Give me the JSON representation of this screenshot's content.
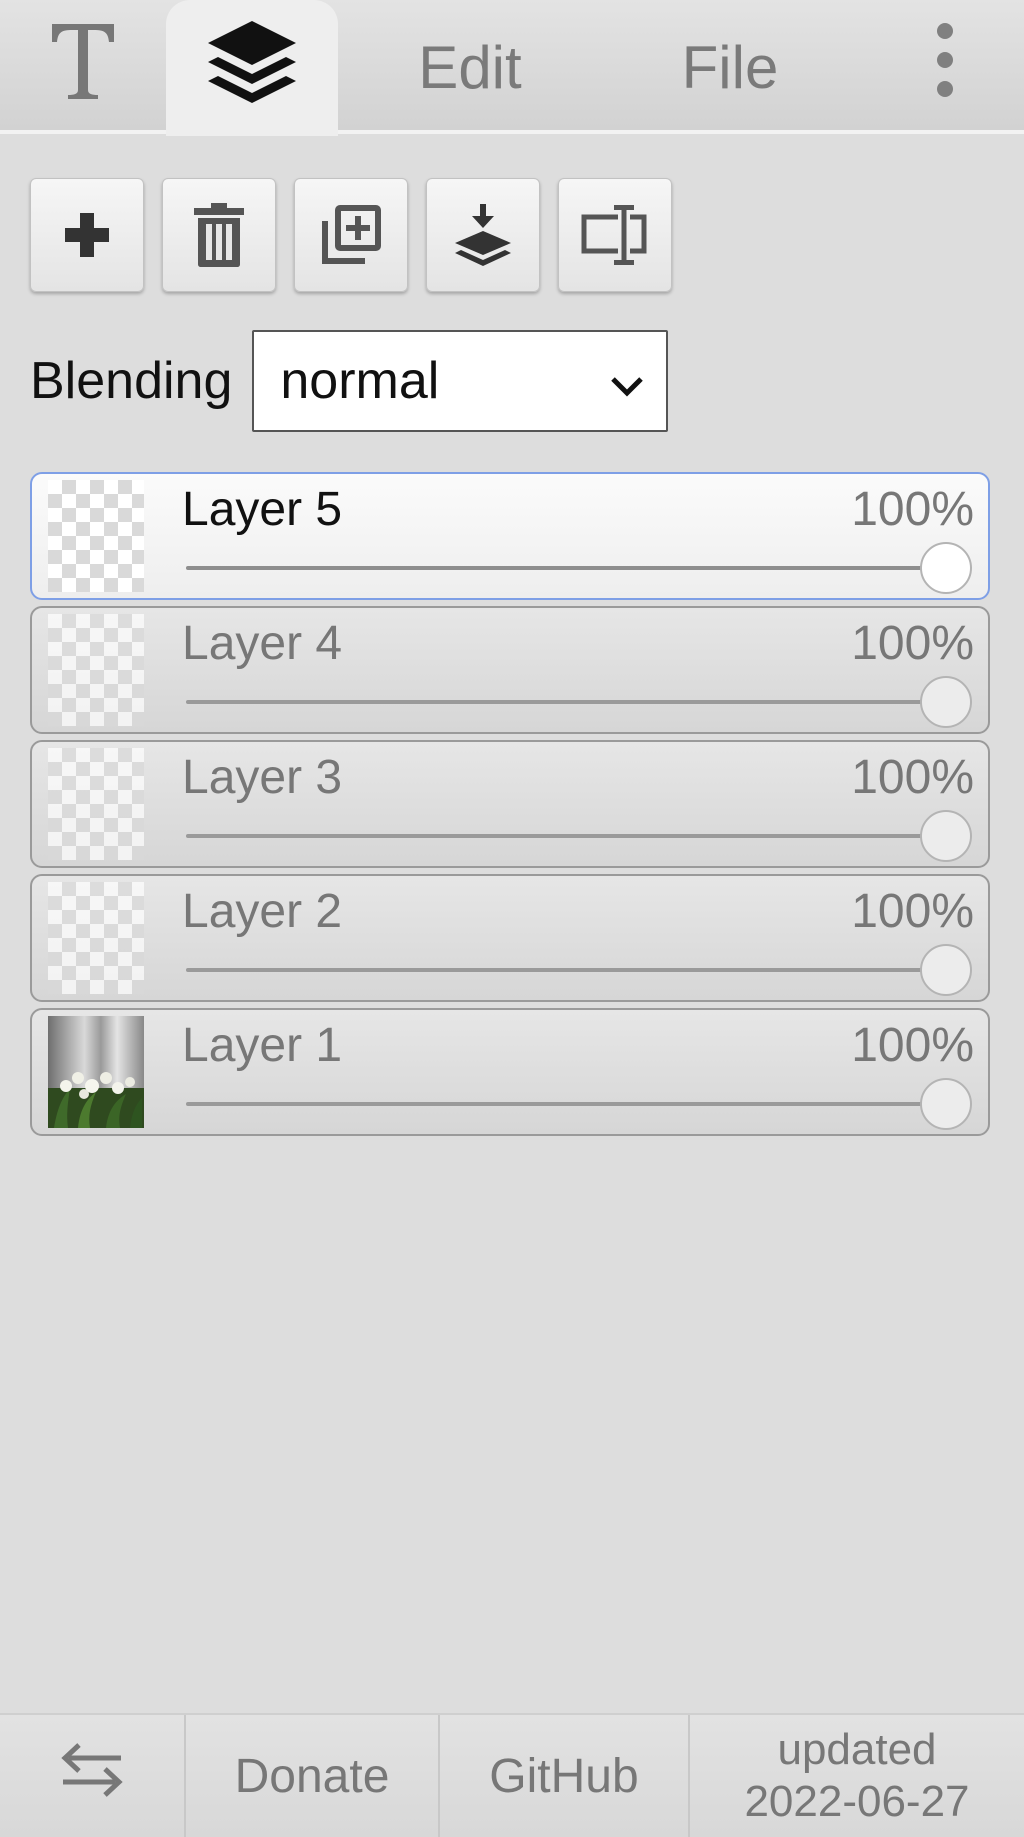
{
  "tabs": {
    "text_icon": "text-tool-icon",
    "layers_icon": "layers-icon",
    "edit_label": "Edit",
    "file_label": "File",
    "more_icon": "more-vertical-icon"
  },
  "toolbar": {
    "buttons": [
      {
        "icon": "plus-icon"
      },
      {
        "icon": "trash-icon"
      },
      {
        "icon": "duplicate-icon"
      },
      {
        "icon": "merge-down-icon"
      },
      {
        "icon": "rename-icon"
      }
    ]
  },
  "blending": {
    "label": "Blending",
    "value": "normal"
  },
  "layers": [
    {
      "name": "Layer 5",
      "opacity": "100%",
      "opacity_value": 1.0,
      "active": true
    },
    {
      "name": "Layer 4",
      "opacity": "100%",
      "opacity_value": 1.0,
      "active": false
    },
    {
      "name": "Layer 3",
      "opacity": "100%",
      "opacity_value": 1.0,
      "active": false
    },
    {
      "name": "Layer 2",
      "opacity": "100%",
      "opacity_value": 1.0,
      "active": false
    },
    {
      "name": "Layer 1",
      "opacity": "100%",
      "opacity_value": 1.0,
      "active": false
    }
  ],
  "footer": {
    "swap_icon": "swap-arrows-icon",
    "donate": "Donate",
    "github": "GitHub",
    "updated_line1": "updated",
    "updated_line2": "2022-06-27"
  },
  "colors": {
    "background": "#dddddd",
    "active_border": "#7e9fe6",
    "text_inactive": "#777777"
  }
}
